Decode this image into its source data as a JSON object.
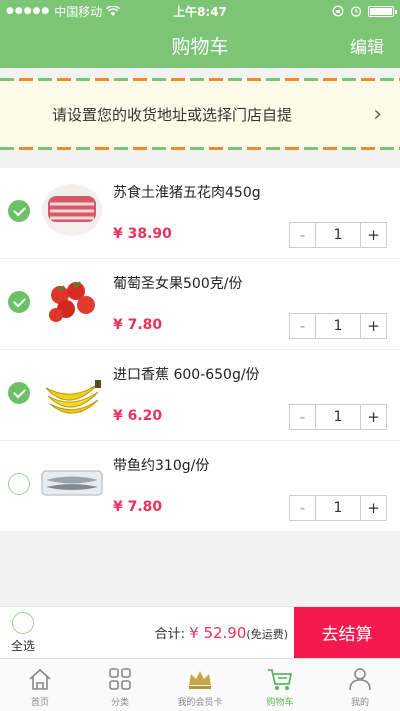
{
  "status": {
    "carrier": "中国移动",
    "time": "上午8:47"
  },
  "header": {
    "title": "购物车",
    "edit": "编辑"
  },
  "address": {
    "text": "请设置您的收货地址或选择门店自提",
    "chevron": "›"
  },
  "cart": {
    "items": [
      {
        "name": "苏食土淮猪五花肉450g",
        "price": "¥ 38.90",
        "qty": "1",
        "checked": true,
        "image": "pork-belly"
      },
      {
        "name": "葡萄圣女果500克/份",
        "price": "¥ 7.80",
        "qty": "1",
        "checked": true,
        "image": "cherry-tomatoes"
      },
      {
        "name": "进口香蕉 600-650g/份",
        "price": "¥ 6.20",
        "qty": "1",
        "checked": true,
        "image": "bananas"
      },
      {
        "name": "带鱼约310g/份",
        "price": "¥ 7.80",
        "qty": "1",
        "checked": false,
        "image": "ribbonfish"
      }
    ],
    "minus": "-",
    "plus": "+"
  },
  "footer": {
    "select_all": "全选",
    "total_label": "合计:",
    "total_amount": "¥ 52.90",
    "total_note": "(免运费)",
    "checkout": "去结算"
  },
  "tabs": [
    {
      "label": "首页",
      "icon": "home-icon"
    },
    {
      "label": "分类",
      "icon": "grid-icon"
    },
    {
      "label": "我的会员卡",
      "icon": "crown-icon"
    },
    {
      "label": "购物车",
      "icon": "cart-icon",
      "active": true
    },
    {
      "label": "我的",
      "icon": "user-icon"
    }
  ],
  "colors": {
    "primary": "#7cc576",
    "accent": "#f5194f",
    "price": "#e8345a"
  }
}
